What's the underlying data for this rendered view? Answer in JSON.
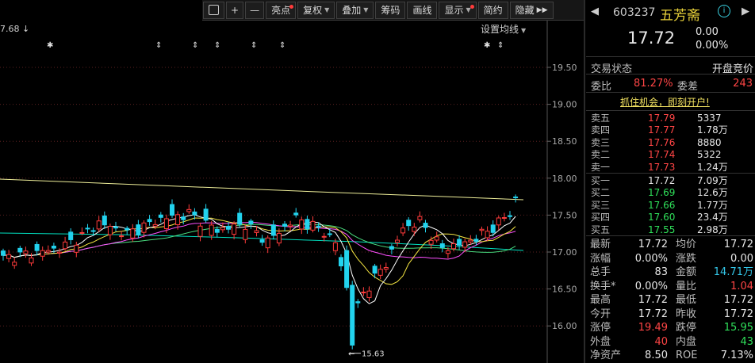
{
  "toolbar": {
    "buttons": [
      {
        "label": "",
        "icon": "screenshot-icon"
      },
      {
        "label": "+",
        "icon": "zoom-in-icon"
      },
      {
        "label": "—",
        "icon": "zoom-out-icon"
      },
      {
        "label": "亮点",
        "dot": true
      },
      {
        "label": "复权",
        "arrow": true
      },
      {
        "label": "叠加",
        "arrow": true
      },
      {
        "label": "筹码"
      },
      {
        "label": "画线"
      },
      {
        "label": "显示",
        "arrow": true,
        "dot": true
      },
      {
        "label": "简约"
      },
      {
        "label": "隐藏",
        "icon": "double-arrow-right-icon"
      }
    ]
  },
  "chart": {
    "left_marker": "7.68 ↓",
    "ma_settings_label": "设置均线",
    "low_marker": "15.63",
    "price_ticks": [
      "19.50",
      "19.00",
      "18.50",
      "18.00",
      "17.50",
      "17.00",
      "16.50",
      "16.00"
    ],
    "colors": {
      "up": "#ff3b3b",
      "down": "#22d3ee",
      "ma5": "#ffffff",
      "ma10": "#f5e642",
      "ma20": "#ff4fff",
      "ma30": "#4ade80",
      "ma60": "#00e0c0",
      "ma250": "#eeee99"
    }
  },
  "quote": {
    "code": "603237",
    "name": "五芳斋",
    "price": "17.72",
    "change": "0.00",
    "change_pct": "0.00%",
    "status_label": "交易状态",
    "status_value": "开盘竞价",
    "ratio_label": "委比",
    "ratio_value": "81.27%",
    "diff_label": "委差",
    "diff_value": "243",
    "promo": "抓住机会，即刻开户!",
    "asks": [
      {
        "label": "卖五",
        "price": "17.79",
        "vol": "5337"
      },
      {
        "label": "卖四",
        "price": "17.77",
        "vol": "1.78万"
      },
      {
        "label": "卖三",
        "price": "17.76",
        "vol": "8880"
      },
      {
        "label": "卖二",
        "price": "17.74",
        "vol": "5322"
      },
      {
        "label": "卖一",
        "price": "17.73",
        "vol": "1.24万"
      }
    ],
    "bids": [
      {
        "label": "买一",
        "price": "17.72",
        "vol": "7.09万"
      },
      {
        "label": "买二",
        "price": "17.69",
        "vol": "12.6万"
      },
      {
        "label": "买三",
        "price": "17.66",
        "vol": "1.77万"
      },
      {
        "label": "买四",
        "price": "17.60",
        "vol": "23.4万"
      },
      {
        "label": "买五",
        "price": "17.55",
        "vol": "2.98万"
      }
    ],
    "stats": [
      {
        "l1": "最新",
        "v1": "17.72",
        "c1": "w",
        "l2": "均价",
        "v2": "17.72",
        "c2": "w"
      },
      {
        "l1": "涨幅",
        "v1": "0.00%",
        "c1": "w",
        "l2": "涨跌",
        "v2": "0.00",
        "c2": "w"
      },
      {
        "l1": "总手",
        "v1": "83",
        "c1": "w",
        "l2": "金额",
        "v2": "14.71万",
        "c2": "c"
      },
      {
        "l1": "换手*",
        "v1": "0.00%",
        "c1": "w",
        "l2": "量比",
        "v2": "1.04",
        "c2": "r"
      },
      {
        "l1": "最高",
        "v1": "17.72",
        "c1": "w",
        "l2": "最低",
        "v2": "17.72",
        "c2": "w"
      },
      {
        "l1": "今开",
        "v1": "17.72",
        "c1": "w",
        "l2": "昨收",
        "v2": "17.72",
        "c2": "w"
      },
      {
        "l1": "涨停",
        "v1": "19.49",
        "c1": "r",
        "l2": "跌停",
        "v2": "15.95",
        "c2": "g"
      },
      {
        "l1": "外盘",
        "v1": "40",
        "c1": "r",
        "l2": "内盘",
        "v2": "43",
        "c2": "g"
      },
      {
        "l1": "净资产",
        "v1": "8.50",
        "c1": "w",
        "l2": "ROE",
        "v2": "7.13%",
        "c2": "w"
      }
    ]
  }
}
